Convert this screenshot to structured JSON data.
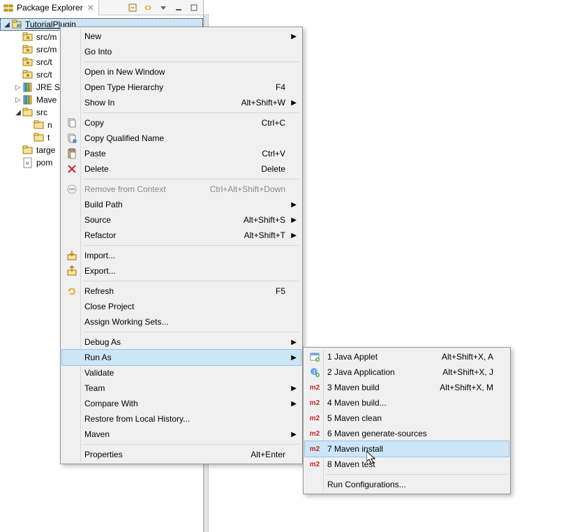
{
  "view": {
    "title": "Package Explorer",
    "toolbar": {
      "collapse_all": "Collapse All",
      "link": "Link with Editor",
      "menu": "View Menu",
      "min": "Minimize",
      "max": "Maximize"
    }
  },
  "tree": [
    {
      "label": "TutorialPlugin",
      "depth": 0,
      "expander": "▾",
      "icon": "project",
      "selected": true
    },
    {
      "label": "src/m",
      "depth": 1,
      "expander": "",
      "icon": "pkgfolder"
    },
    {
      "label": "src/m",
      "depth": 1,
      "expander": "",
      "icon": "pkgfolder"
    },
    {
      "label": "src/t",
      "depth": 1,
      "expander": "",
      "icon": "pkgfolder"
    },
    {
      "label": "src/t",
      "depth": 1,
      "expander": "",
      "icon": "pkgfolder"
    },
    {
      "label": "JRE S",
      "depth": 1,
      "expander": "▸",
      "icon": "library"
    },
    {
      "label": "Mave",
      "depth": 1,
      "expander": "▸",
      "icon": "library"
    },
    {
      "label": "src",
      "depth": 1,
      "expander": "▾",
      "icon": "folder"
    },
    {
      "label": "n",
      "depth": 2,
      "expander": "",
      "icon": "folder"
    },
    {
      "label": "t",
      "depth": 2,
      "expander": "",
      "icon": "folder"
    },
    {
      "label": "targe",
      "depth": 1,
      "expander": "",
      "icon": "folder"
    },
    {
      "label": "pom",
      "depth": 1,
      "expander": "",
      "icon": "xml"
    }
  ],
  "menu1": [
    {
      "type": "item",
      "label": "New",
      "submenu": true
    },
    {
      "type": "item",
      "label": "Go Into"
    },
    {
      "type": "sep"
    },
    {
      "type": "item",
      "label": "Open in New Window"
    },
    {
      "type": "item",
      "label": "Open Type Hierarchy",
      "accel": "F4"
    },
    {
      "type": "item",
      "label": "Show In",
      "accel": "Alt+Shift+W",
      "submenu": true
    },
    {
      "type": "sep"
    },
    {
      "type": "item",
      "label": "Copy",
      "accel": "Ctrl+C",
      "icon": "copy"
    },
    {
      "type": "item",
      "label": "Copy Qualified Name",
      "icon": "copyq"
    },
    {
      "type": "item",
      "label": "Paste",
      "accel": "Ctrl+V",
      "icon": "paste"
    },
    {
      "type": "item",
      "label": "Delete",
      "accel": "Delete",
      "icon": "delete"
    },
    {
      "type": "sep"
    },
    {
      "type": "item",
      "label": "Remove from Context",
      "accel": "Ctrl+Alt+Shift+Down",
      "icon": "remove",
      "disabled": true
    },
    {
      "type": "item",
      "label": "Build Path",
      "submenu": true
    },
    {
      "type": "item",
      "label": "Source",
      "accel": "Alt+Shift+S",
      "submenu": true
    },
    {
      "type": "item",
      "label": "Refactor",
      "accel": "Alt+Shift+T",
      "submenu": true
    },
    {
      "type": "sep"
    },
    {
      "type": "item",
      "label": "Import...",
      "icon": "import"
    },
    {
      "type": "item",
      "label": "Export...",
      "icon": "export"
    },
    {
      "type": "sep"
    },
    {
      "type": "item",
      "label": "Refresh",
      "accel": "F5",
      "icon": "refresh"
    },
    {
      "type": "item",
      "label": "Close Project"
    },
    {
      "type": "item",
      "label": "Assign Working Sets..."
    },
    {
      "type": "sep"
    },
    {
      "type": "item",
      "label": "Debug As",
      "submenu": true
    },
    {
      "type": "item",
      "label": "Run As",
      "submenu": true,
      "highlight": true
    },
    {
      "type": "item",
      "label": "Validate"
    },
    {
      "type": "item",
      "label": "Team",
      "submenu": true
    },
    {
      "type": "item",
      "label": "Compare With",
      "submenu": true
    },
    {
      "type": "item",
      "label": "Restore from Local History..."
    },
    {
      "type": "item",
      "label": "Maven",
      "submenu": true
    },
    {
      "type": "sep"
    },
    {
      "type": "item",
      "label": "Properties",
      "accel": "Alt+Enter"
    }
  ],
  "menu2": [
    {
      "type": "item",
      "label": "1 Java Applet",
      "accel": "Alt+Shift+X, A",
      "icon": "applet"
    },
    {
      "type": "item",
      "label": "2 Java Application",
      "accel": "Alt+Shift+X, J",
      "icon": "javaapp"
    },
    {
      "type": "item",
      "label": "3 Maven build",
      "accel": "Alt+Shift+X, M",
      "icon": "m2"
    },
    {
      "type": "item",
      "label": "4 Maven build...",
      "icon": "m2"
    },
    {
      "type": "item",
      "label": "5 Maven clean",
      "icon": "m2"
    },
    {
      "type": "item",
      "label": "6 Maven generate-sources",
      "icon": "m2"
    },
    {
      "type": "item",
      "label": "7 Maven install",
      "icon": "m2",
      "highlight": true
    },
    {
      "type": "item",
      "label": "8 Maven test",
      "icon": "m2"
    },
    {
      "type": "sep"
    },
    {
      "type": "item",
      "label": "Run Configurations..."
    }
  ]
}
